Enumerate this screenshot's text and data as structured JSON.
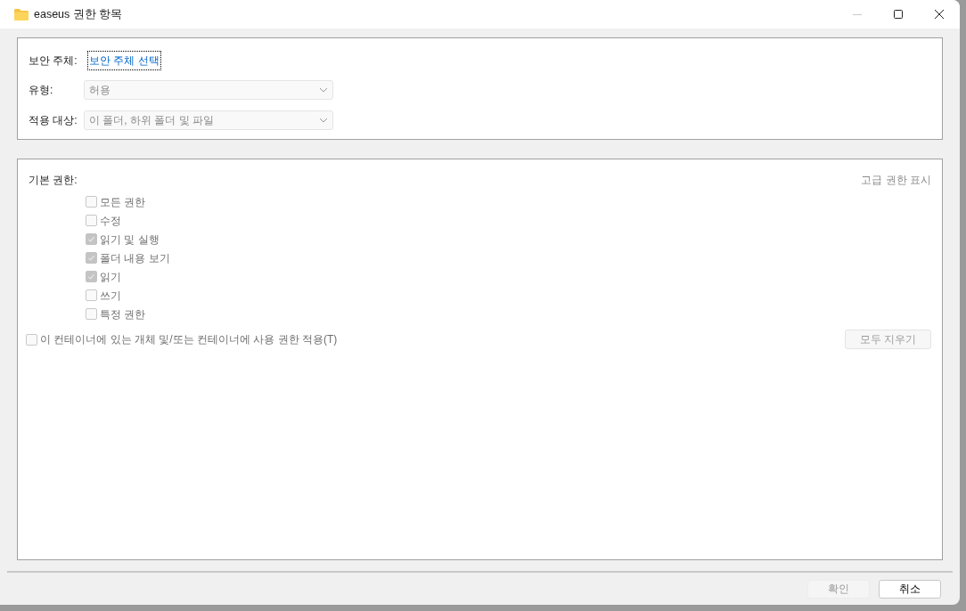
{
  "window": {
    "title": "easeus 권한 항목"
  },
  "principal": {
    "label": "보안 주체:",
    "link": "보안 주체 선택"
  },
  "type_field": {
    "label": "유형:",
    "value": "허용"
  },
  "applies_to": {
    "label": "적용 대상:",
    "value": "이 폴더, 하위 폴더 및 파일"
  },
  "permissions": {
    "title": "기본 권한:",
    "advanced_link": "고급 권한 표시",
    "items": [
      {
        "label": "모든 권한",
        "checked": false
      },
      {
        "label": "수정",
        "checked": false
      },
      {
        "label": "읽기 및 실행",
        "checked": true
      },
      {
        "label": "폴더 내용 보기",
        "checked": true
      },
      {
        "label": "읽기",
        "checked": true
      },
      {
        "label": "쓰기",
        "checked": false
      },
      {
        "label": "특정 권한",
        "checked": false
      }
    ],
    "inherit": {
      "label": "이 컨테이너에 있는 개체 및/또는 컨테이너에 사용 권한 적용(T)",
      "checked": false
    },
    "clear_button": {
      "label": "모두 지우기",
      "disabled": true
    }
  },
  "buttons": [
    {
      "label": "확인",
      "disabled": true
    },
    {
      "label": "취소",
      "disabled": false
    }
  ]
}
